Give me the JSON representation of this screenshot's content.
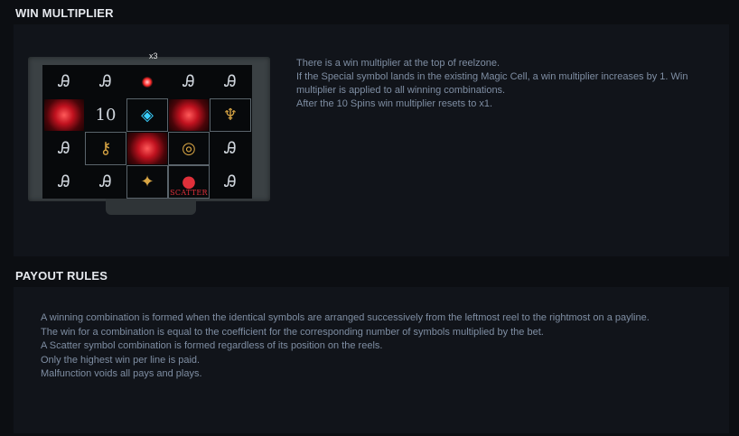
{
  "sections": {
    "win_multiplier": {
      "title": "WIN MULTIPLIER",
      "image": {
        "badge": "x3",
        "scatter_label": "SCATTER",
        "reels": [
          [
            "a",
            "a",
            "magic",
            "a",
            "a"
          ],
          [
            "magic",
            "10",
            "gem",
            "magic",
            "goblet"
          ],
          [
            "a",
            "keys",
            "magic",
            "watch",
            "a"
          ],
          [
            "a",
            "a",
            "cat",
            "scatter",
            "a"
          ]
        ]
      },
      "description": [
        "There is a win multiplier at the top of reelzone.",
        "If the Special symbol lands in the existing Magic Cell, a win multiplier increases by 1. Win multiplier is applied to all winning combinations.",
        "After the 10 Spins win multiplier resets to x1."
      ]
    },
    "payout_rules": {
      "title": "PAYOUT RULES",
      "description": [
        "A winning combination is formed when the identical symbols are arranged successively from the leftmost reel to the rightmost on a payline.",
        "The win for a combination is equal to the coefficient for the corresponding number of symbols multiplied by the bet.",
        "A Scatter symbol combination is formed regardless of its position on the reels.",
        "Only the highest win per line is paid.",
        "Malfunction voids all pays and plays."
      ]
    }
  },
  "symbol_glyphs": {
    "a": "Ꭿ",
    "10": "10"
  },
  "colors": {
    "background": "#0c0e12",
    "panel": "#11141a",
    "title": "#e6e9ee",
    "body_text": "#7f8ea3",
    "magic_red": "#c1121f"
  }
}
